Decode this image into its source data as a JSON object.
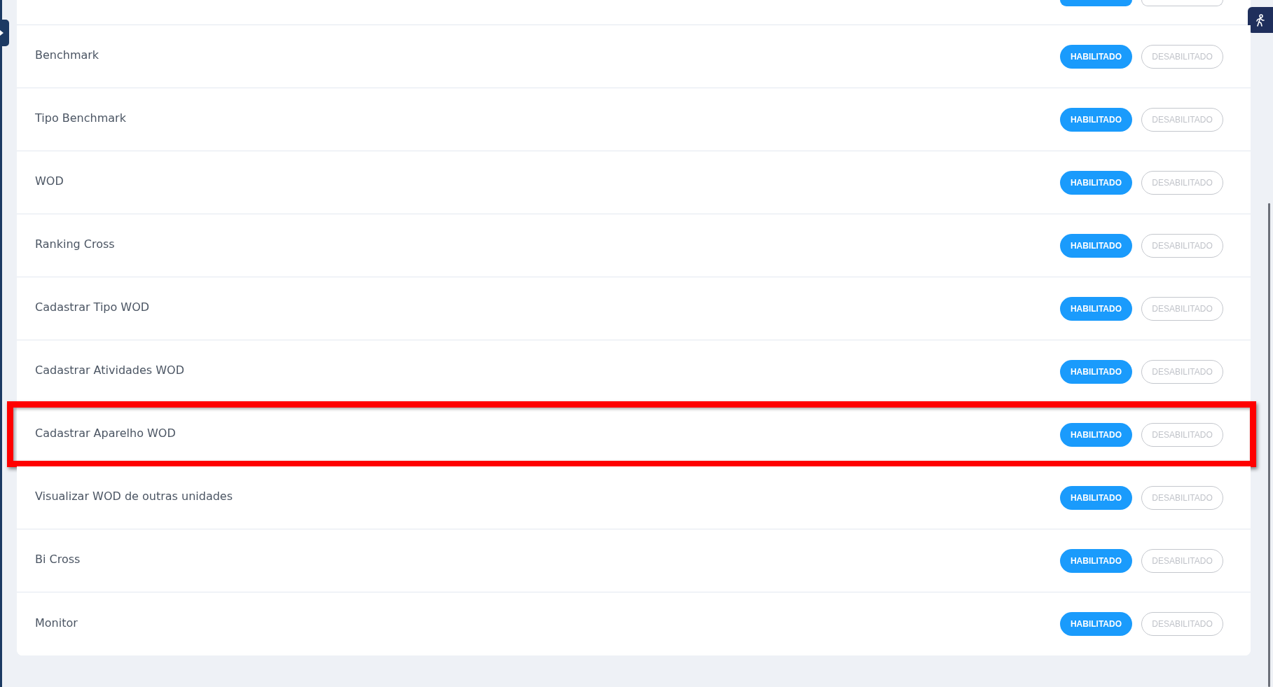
{
  "partial_row": {
    "enabled": true
  },
  "rows": [
    {
      "label": "Benchmark",
      "enabled": true,
      "highlighted": false,
      "on_label": "HABILITADO",
      "off_label": "DESABILITADO"
    },
    {
      "label": "Tipo Benchmark",
      "enabled": true,
      "highlighted": false,
      "on_label": "HABILITADO",
      "off_label": "DESABILITADO"
    },
    {
      "label": "WOD",
      "enabled": true,
      "highlighted": false,
      "on_label": "HABILITADO",
      "off_label": "DESABILITADO"
    },
    {
      "label": "Ranking Cross",
      "enabled": true,
      "highlighted": false,
      "on_label": "HABILITADO",
      "off_label": "DESABILITADO"
    },
    {
      "label": "Cadastrar Tipo WOD",
      "enabled": true,
      "highlighted": false,
      "on_label": "HABILITADO",
      "off_label": "DESABILITADO"
    },
    {
      "label": "Cadastrar Atividades WOD",
      "enabled": true,
      "highlighted": false,
      "on_label": "HABILITADO",
      "off_label": "DESABILITADO"
    },
    {
      "label": "Cadastrar Aparelho WOD",
      "enabled": true,
      "highlighted": true,
      "on_label": "HABILITADO",
      "off_label": "DESABILITADO"
    },
    {
      "label": "Visualizar WOD de outras unidades",
      "enabled": true,
      "highlighted": false,
      "on_label": "HABILITADO",
      "off_label": "DESABILITADO"
    },
    {
      "label": "Bi Cross",
      "enabled": true,
      "highlighted": false,
      "on_label": "HABILITADO",
      "off_label": "DESABILITADO"
    },
    {
      "label": "Monitor",
      "enabled": true,
      "highlighted": false,
      "on_label": "HABILITADO",
      "off_label": "DESABILITADO"
    }
  ]
}
